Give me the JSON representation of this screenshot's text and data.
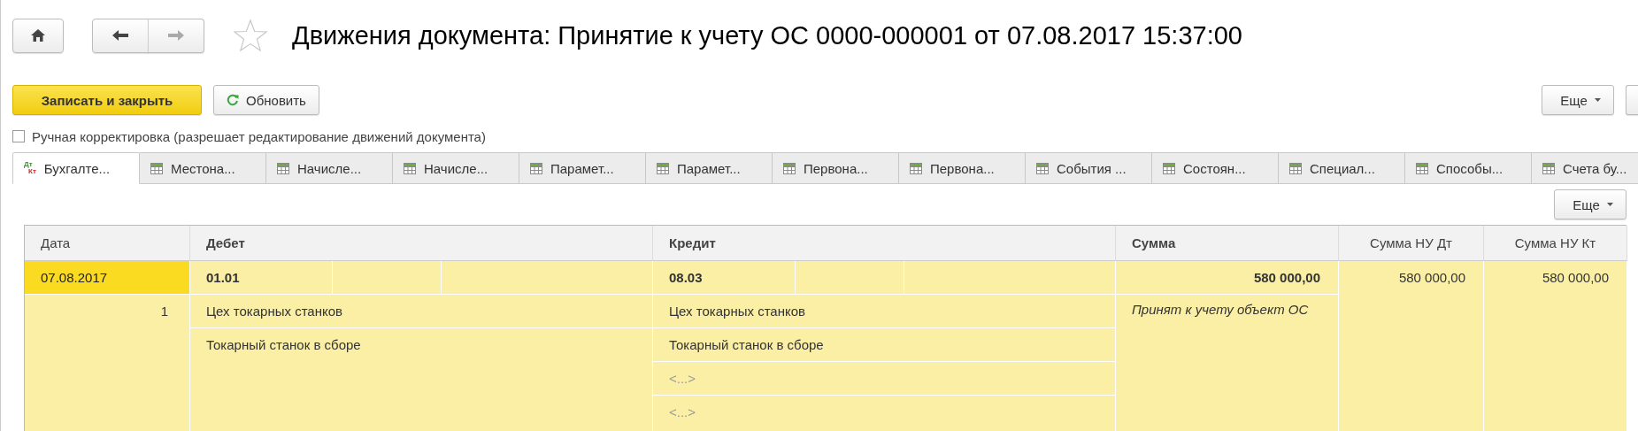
{
  "title": "Движения документа: Принятие к учету ОС 0000-000001 от 07.08.2017 15:37:00",
  "favorite": false,
  "toolbar": {
    "buttons": [
      {
        "label": "Записать и закрыть",
        "kind": "primary"
      },
      {
        "label": "Обновить",
        "kind": "refresh"
      }
    ],
    "more": "Еще"
  },
  "manual_correction": {
    "label": "Ручная корректировка (разрешает редактирование движений документа)",
    "checked": false
  },
  "tabs": [
    {
      "label": "Бухгалте...",
      "kind": "dtkt",
      "icon_labels": [
        "Дт",
        "Кт"
      ],
      "selected": true
    },
    {
      "label": "Местона...",
      "kind": "table",
      "selected": false
    },
    {
      "label": "Начисле...",
      "kind": "table",
      "selected": false
    },
    {
      "label": "Начисле...",
      "kind": "table",
      "selected": false
    },
    {
      "label": "Парамет...",
      "kind": "table",
      "selected": false
    },
    {
      "label": "Парамет...",
      "kind": "table",
      "selected": false
    },
    {
      "label": "Первона...",
      "kind": "table",
      "selected": false
    },
    {
      "label": "Первона...",
      "kind": "table",
      "selected": false
    },
    {
      "label": "События ...",
      "kind": "table",
      "selected": false
    },
    {
      "label": "Состоян...",
      "kind": "table",
      "selected": false
    },
    {
      "label": "Специал...",
      "kind": "table",
      "selected": false
    },
    {
      "label": "Способы...",
      "kind": "table",
      "selected": false
    },
    {
      "label": "Счета бу...",
      "kind": "table",
      "selected": false
    }
  ],
  "table_more": "Еще",
  "table": {
    "columns": [
      {
        "label": "Дата",
        "bold": false
      },
      {
        "label": "Дебет",
        "bold": true
      },
      {
        "label": "Кредит",
        "bold": true
      },
      {
        "label": "Сумма",
        "bold": true
      },
      {
        "label": "Сумма НУ Дт",
        "bold": false
      },
      {
        "label": "Сумма НУ Кт",
        "bold": false
      }
    ],
    "rows": [
      {
        "selected": true,
        "date": "07.08.2017",
        "number": "1",
        "debit": {
          "account": "01.01",
          "subconto": [
            {
              "text": "Цех токарных станков",
              "kind": "value"
            },
            {
              "text": "Токарный станок в сборе",
              "kind": "value"
            }
          ]
        },
        "credit": {
          "account": "08.03",
          "subconto": [
            {
              "text": "Цех токарных станков",
              "kind": "value"
            },
            {
              "text": "Токарный станок в сборе",
              "kind": "value"
            },
            {
              "text": "<...>",
              "kind": "empty"
            },
            {
              "text": "<...>",
              "kind": "empty"
            }
          ]
        },
        "sum": "580 000,00",
        "content": "Принят к учету объект ОС",
        "sum_nu_dt": "580 000,00",
        "sum_nu_kt": "580 000,00"
      }
    ]
  }
}
